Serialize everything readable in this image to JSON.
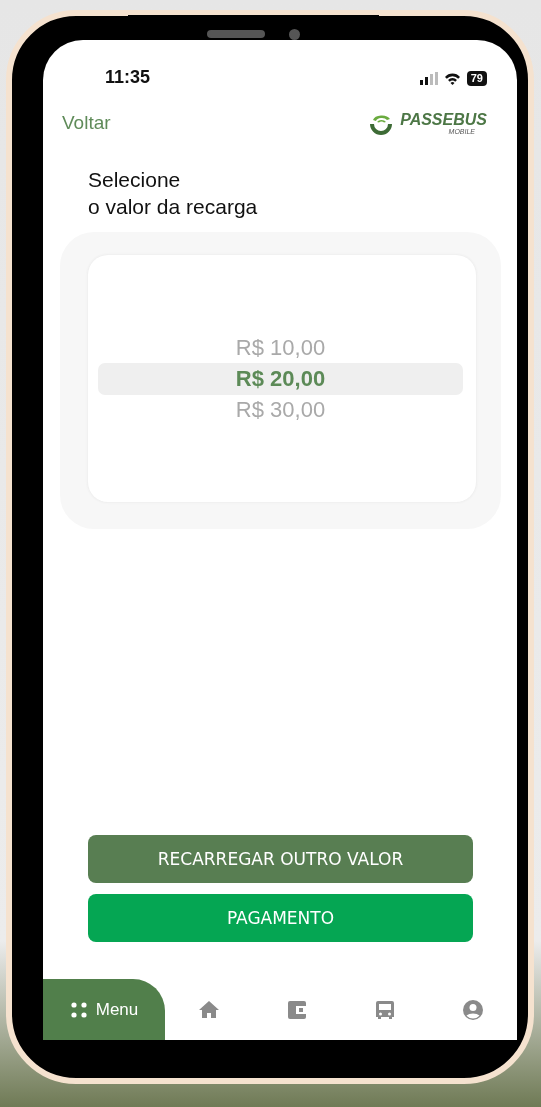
{
  "status_bar": {
    "time": "11:35",
    "battery": "79"
  },
  "header": {
    "back": "Voltar",
    "logo": {
      "brand": "PASSEBUS",
      "tagline": "MOBILE"
    }
  },
  "title_lines": [
    "Selecione",
    "o valor da recarga"
  ],
  "picker": {
    "options": [
      {
        "label": "R$ 10,00",
        "selected": false
      },
      {
        "label": "R$ 20,00",
        "selected": true
      },
      {
        "label": "R$ 30,00",
        "selected": false
      }
    ]
  },
  "buttons": [
    {
      "label": "RECARREGAR OUTRO VALOR",
      "kind": "secondary"
    },
    {
      "label": "PAGAMENTO",
      "kind": "primary"
    }
  ],
  "tab_bar": [
    {
      "kind": "menu",
      "label": "Menu",
      "selected": true
    },
    {
      "kind": "home",
      "selected": false
    },
    {
      "kind": "wallet",
      "selected": false
    },
    {
      "kind": "bus",
      "selected": false
    },
    {
      "kind": "account",
      "selected": false
    }
  ]
}
